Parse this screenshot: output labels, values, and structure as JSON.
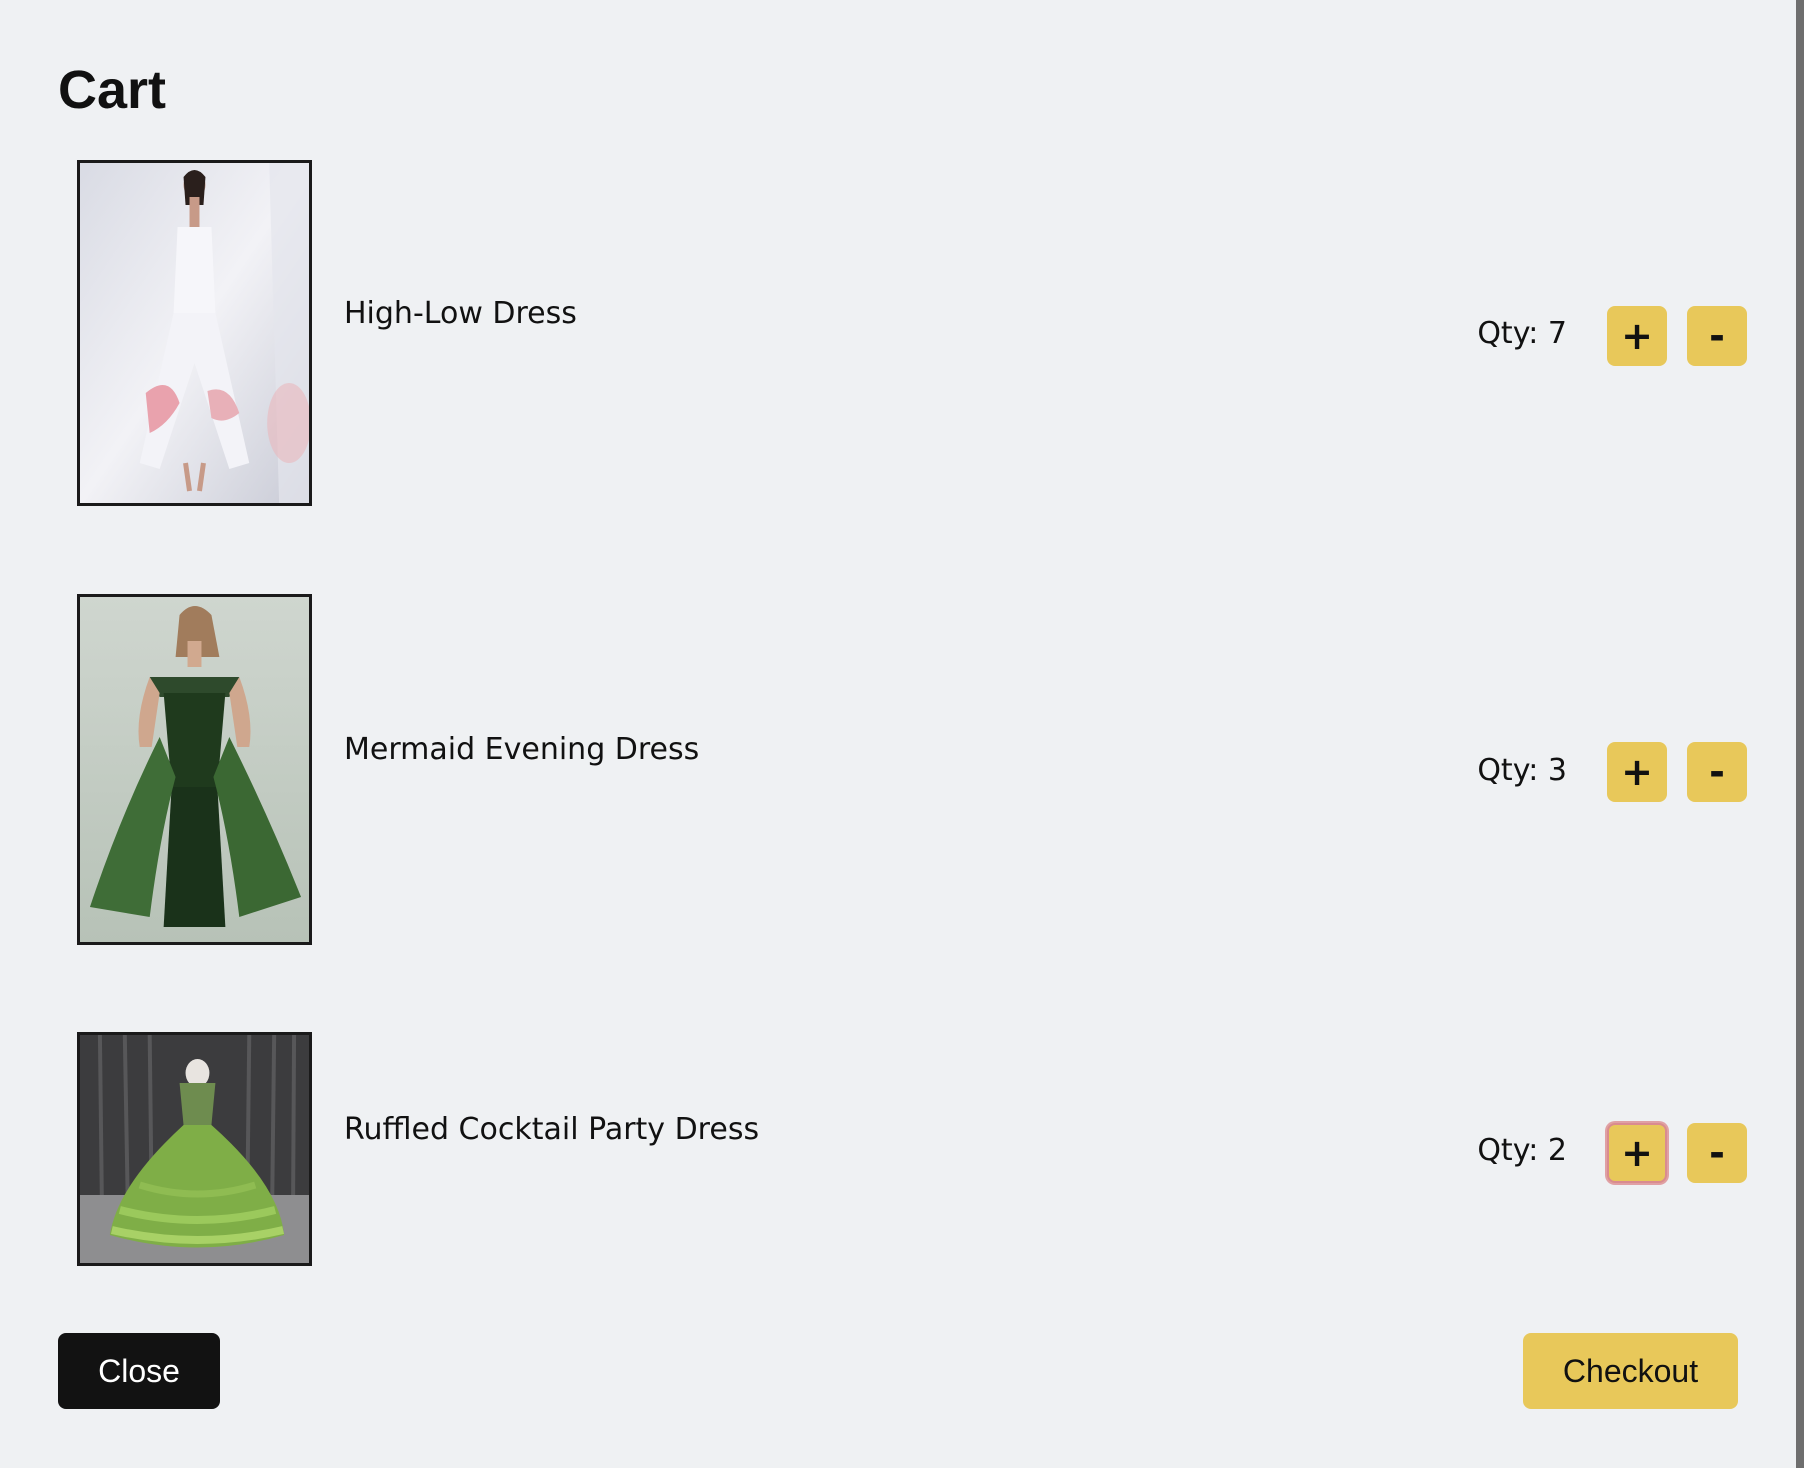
{
  "cart": {
    "title": "Cart",
    "items": [
      {
        "name": "High-Low Dress",
        "qty_label": "Qty: 7",
        "plus_label": "+",
        "minus_label": "-"
      },
      {
        "name": "Mermaid Evening Dress",
        "qty_label": "Qty: 3",
        "plus_label": "+",
        "minus_label": "-"
      },
      {
        "name": "Ruffled Cocktail Party Dress",
        "qty_label": "Qty: 2",
        "plus_label": "+",
        "minus_label": "-"
      }
    ],
    "close_label": "Close",
    "checkout_label": "Checkout"
  },
  "colors": {
    "background": "#eff1f3",
    "accent": "#e8c85a",
    "dark_button": "#121212",
    "focus_ring": "#d98b90"
  },
  "icons": {
    "item_images": [
      "white-high-low-dress-photo",
      "green-mermaid-dress-photo",
      "green-ruffled-ball-gown-photo"
    ]
  }
}
